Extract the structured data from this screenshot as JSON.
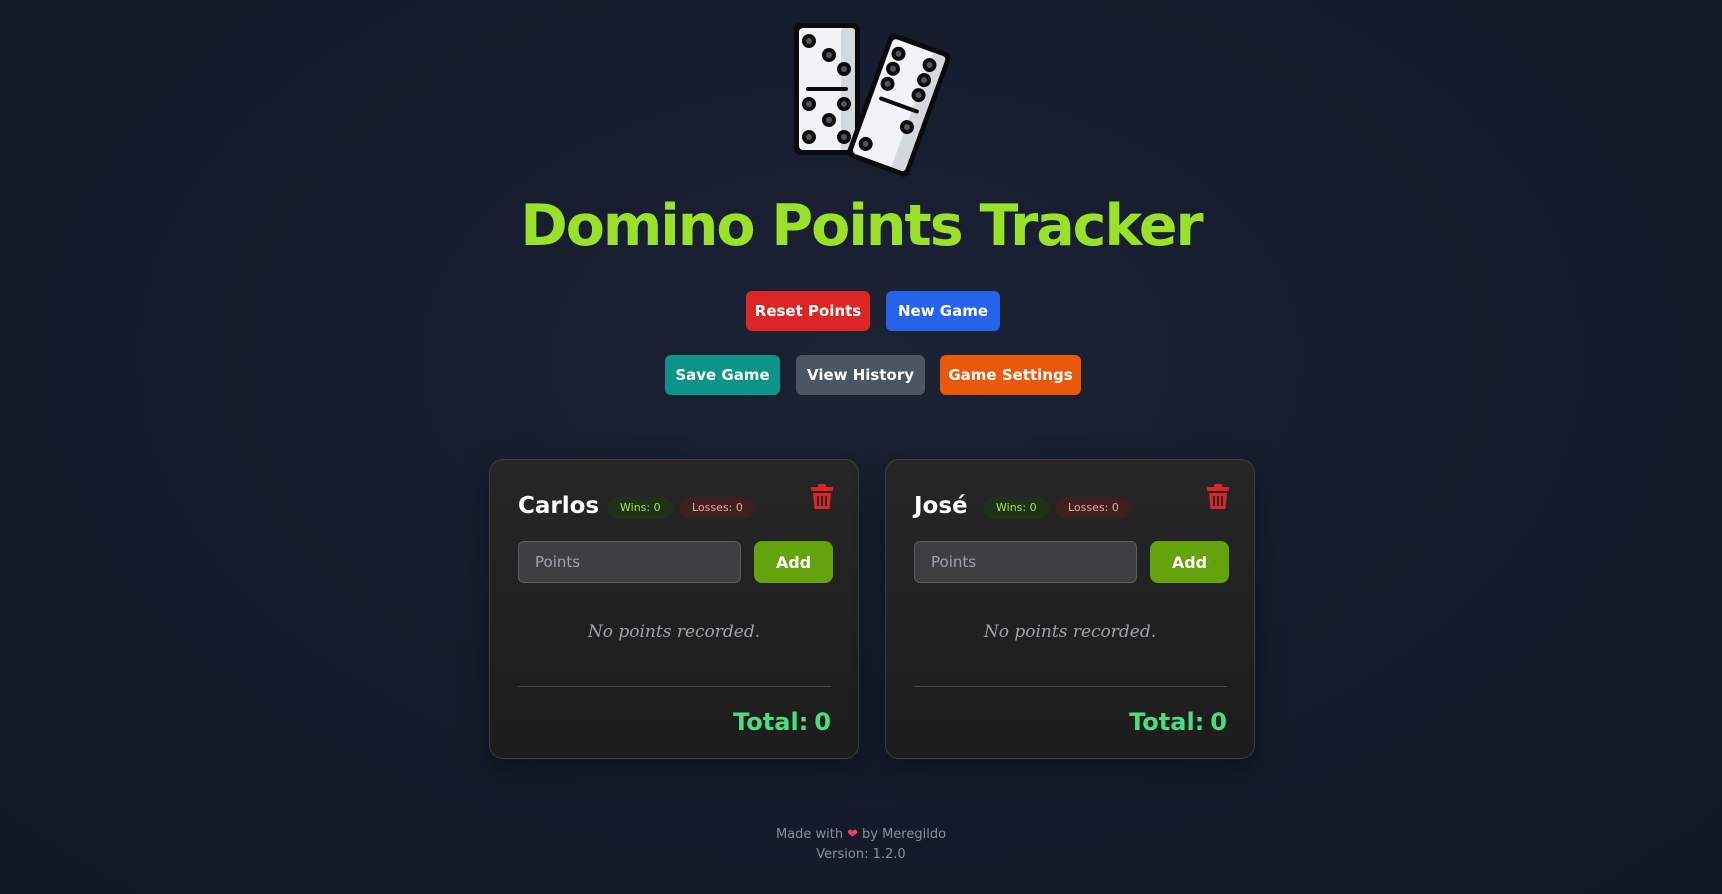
{
  "app": {
    "title": "Domino Points Tracker",
    "logo_icon": "dominoes-icon"
  },
  "actions": {
    "reset_label": "Reset Points",
    "new_game_label": "New Game",
    "save_label": "Save Game",
    "history_label": "View History",
    "settings_label": "Game Settings"
  },
  "colors": {
    "title": "#9be12a",
    "reset": "#dc2626",
    "new_game": "#2563eb",
    "save": "#0d9488",
    "history": "#4b5563",
    "settings": "#ea580c",
    "add": "#65a30d",
    "total": "#4ade80",
    "delete": "#dc2626"
  },
  "players": [
    {
      "name": "Carlos",
      "wins_label": "Wins: 0",
      "losses_label": "Losses: 0",
      "points_placeholder": "Points",
      "add_label": "Add",
      "empty_message": "No points recorded.",
      "total_label": "Total:",
      "total_value": "0",
      "delete_icon": "trash-icon"
    },
    {
      "name": "José",
      "wins_label": "Wins: 0",
      "losses_label": "Losses: 0",
      "points_placeholder": "Points",
      "add_label": "Add",
      "empty_message": "No points recorded.",
      "total_label": "Total:",
      "total_value": "0",
      "delete_icon": "trash-icon"
    }
  ],
  "footer": {
    "made_with": "Made with",
    "heart_icon": "heart-icon",
    "by": "by Meregildo",
    "version": "Version: 1.2.0"
  }
}
